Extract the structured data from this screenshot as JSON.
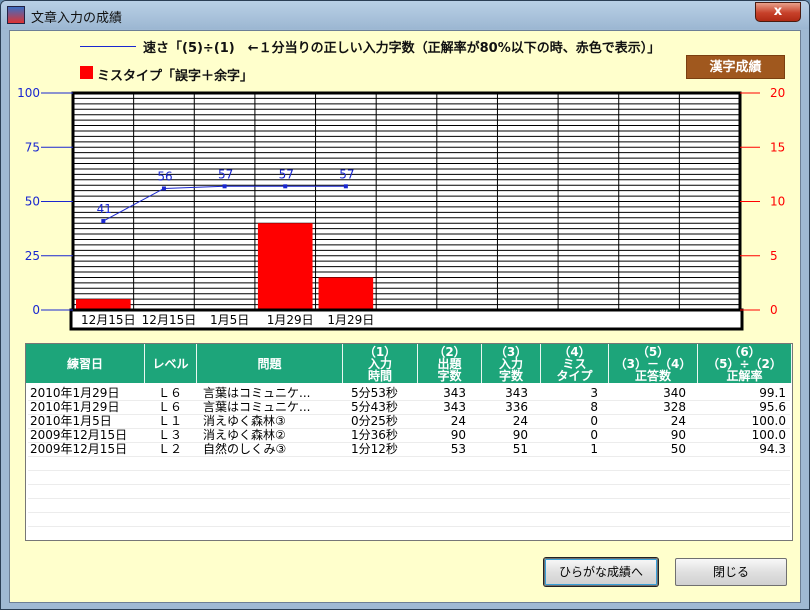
{
  "window": {
    "title": "文章入力の成績",
    "close_label": "x"
  },
  "legend": {
    "speed_text": "速さ「(5)÷(1)　←１分当りの正しい入力字数（正解率が80%以下の時、赤色で表示）」",
    "miss_text": "ミスタイプ「誤字＋余字」",
    "line_color": "#1a27d0",
    "bar_color": "#ff0000"
  },
  "kanji_button_label": "漢字成績",
  "chart_data": {
    "type": "bar",
    "categories": [
      "12月15日",
      "12月15日",
      "1月5日",
      "1月29日",
      "1月29日",
      "",
      "",
      "",
      "",
      "",
      ""
    ],
    "speed_points": [
      {
        "index": 0,
        "value": 41,
        "label": "41"
      },
      {
        "index": 1,
        "value": 56,
        "label": "56"
      },
      {
        "index": 2,
        "value": 57,
        "label": "57"
      },
      {
        "index": 3,
        "value": 57,
        "label": "57"
      },
      {
        "index": 4,
        "value": 57,
        "label": "57"
      }
    ],
    "miss_values": [
      1,
      0,
      0,
      8,
      3,
      null,
      null,
      null,
      null,
      null,
      null
    ],
    "left_axis": {
      "min": 0,
      "max": 100,
      "ticks": [
        "0",
        "25",
        "50",
        "75",
        "100"
      ]
    },
    "right_axis": {
      "min": 0,
      "max": 20,
      "ticks": [
        "0",
        "5",
        "10",
        "15",
        "20"
      ]
    },
    "left_tick_color": "#1a27d0",
    "right_tick_color": "#ff0000"
  },
  "table": {
    "columns": [
      "練習日",
      "レベル",
      "問題",
      "（1）\n入力\n時間",
      "（2）\n出題\n字数",
      "（3）\n入力\n字数",
      "（4）\nミス\nタイプ",
      "（5）\n（3）－（4）\n正答数",
      "（6）\n（5）÷（2）\n正解率"
    ],
    "rows": [
      [
        "2010年1月29日",
        "Ｌ６",
        "言葉はコミュニケ...",
        "5分53秒",
        "343",
        "343",
        "3",
        "340",
        "99.1"
      ],
      [
        "2010年1月29日",
        "Ｌ６",
        "言葉はコミュニケ...",
        "5分43秒",
        "343",
        "336",
        "8",
        "328",
        "95.6"
      ],
      [
        "2010年1月5日",
        "Ｌ１",
        "消えゆく森林③",
        "0分25秒",
        "24",
        "24",
        "0",
        "24",
        "100.0"
      ],
      [
        "2009年12月15日",
        "Ｌ３",
        "消えゆく森林②",
        "1分36秒",
        "90",
        "90",
        "0",
        "90",
        "100.0"
      ],
      [
        "2009年12月15日",
        "Ｌ２",
        "自然のしくみ③",
        "1分12秒",
        "53",
        "51",
        "1",
        "50",
        "94.3"
      ]
    ],
    "header_color": "#1da57a"
  },
  "buttons": {
    "hiragana_label": "ひらがな成績へ",
    "close_label": "閉じる"
  }
}
